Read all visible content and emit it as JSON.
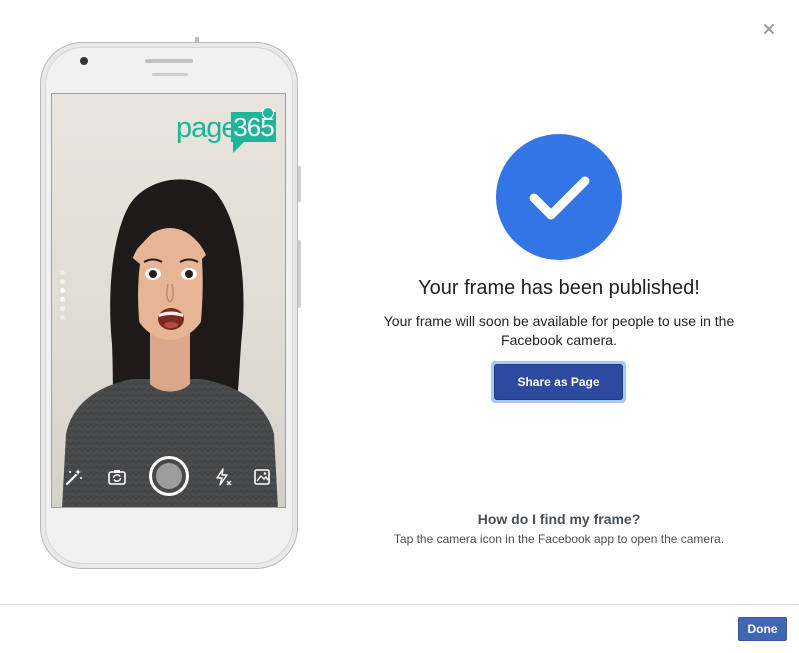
{
  "dialog": {
    "close_icon": "close-icon",
    "close_glyph": "×"
  },
  "phone": {
    "logo": {
      "text": "page",
      "number": "365",
      "color": "#1fb59a"
    },
    "camera_controls": [
      {
        "name": "magic-wand-icon"
      },
      {
        "name": "flip-camera-icon"
      },
      {
        "name": "shutter-button"
      },
      {
        "name": "flash-off-icon"
      },
      {
        "name": "gallery-icon"
      }
    ]
  },
  "success": {
    "icon": "checkmark-icon",
    "circle_color": "#3475e6",
    "title": "Your frame has been published!",
    "description": "Your frame will soon be available for people to use in the Facebook camera.",
    "share_button": "Share as Page"
  },
  "help": {
    "title": "How do I find my frame?",
    "text": "Tap the camera icon in the Facebook app to open the camera."
  },
  "footer": {
    "done_button": "Done",
    "accent": "#4267b2"
  }
}
